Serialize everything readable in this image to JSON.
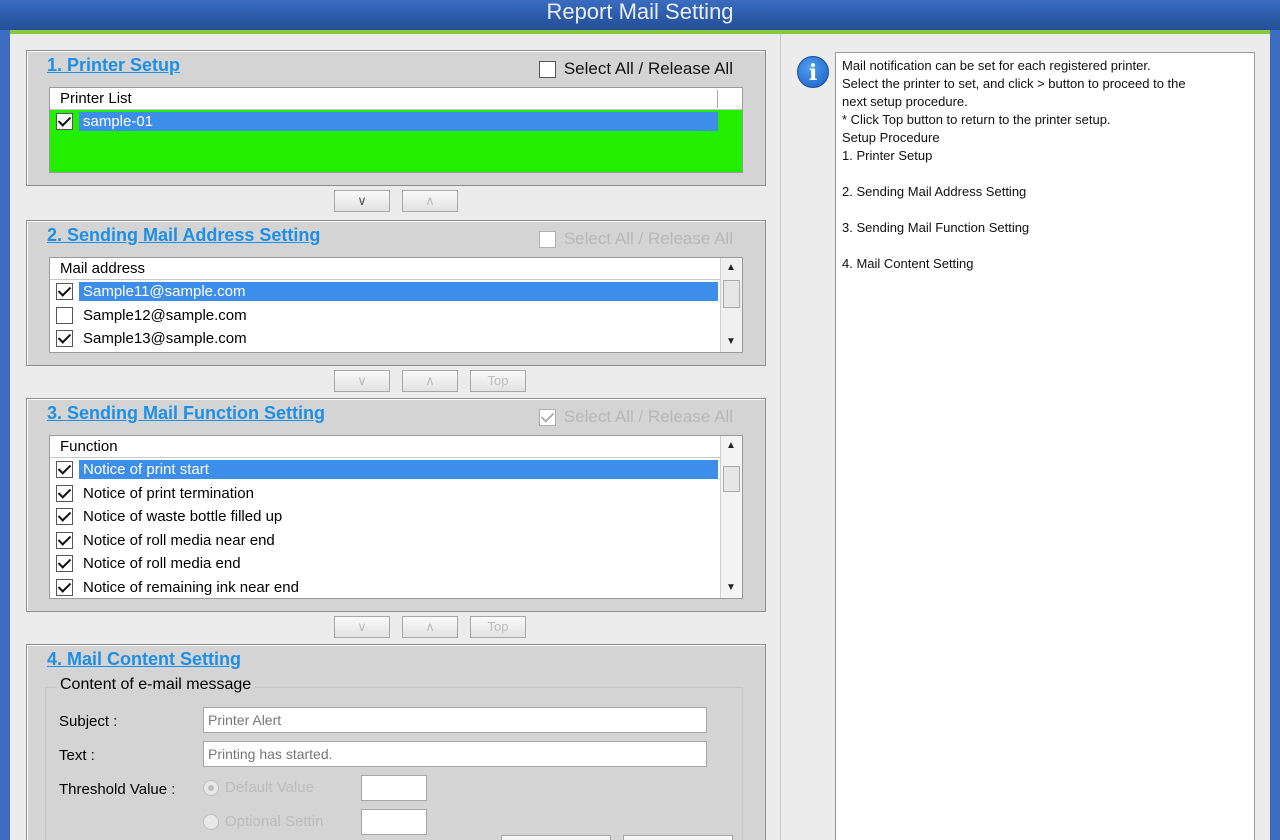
{
  "window": {
    "title": "Report Mail Setting"
  },
  "section1": {
    "title": "1. Printer Setup",
    "select_all_label": "Select All / Release All",
    "list_header": "Printer List",
    "items": [
      {
        "label": "sample-01",
        "checked": true,
        "selected": true
      }
    ]
  },
  "nav1": {
    "down": "∨",
    "up": "∧"
  },
  "section2": {
    "title": "2. Sending Mail Address Setting",
    "select_all_label": "Select All / Release All",
    "list_header": "Mail address",
    "items": [
      {
        "label": "Sample11@sample.com",
        "checked": true,
        "selected": true
      },
      {
        "label": "Sample12@sample.com",
        "checked": false,
        "selected": false
      },
      {
        "label": "Sample13@sample.com",
        "checked": true,
        "selected": false
      }
    ]
  },
  "nav2": {
    "down": "∨",
    "up": "∧",
    "top": "Top"
  },
  "section3": {
    "title": "3. Sending Mail Function Setting",
    "select_all_label": "Select All / Release All",
    "list_header": "Function",
    "items": [
      {
        "label": "Notice of print start",
        "checked": true,
        "selected": true
      },
      {
        "label": "Notice of print termination",
        "checked": true,
        "selected": false
      },
      {
        "label": "Notice of waste bottle filled up",
        "checked": true,
        "selected": false
      },
      {
        "label": "Notice of roll media near end",
        "checked": true,
        "selected": false
      },
      {
        "label": "Notice of roll media end",
        "checked": true,
        "selected": false
      },
      {
        "label": "Notice of remaining ink near end",
        "checked": true,
        "selected": false
      }
    ]
  },
  "nav3": {
    "down": "∨",
    "up": "∧",
    "top": "Top"
  },
  "section4": {
    "title": "4. Mail Content Setting",
    "group_label": "Content of e-mail message",
    "subject_label": "Subject :",
    "subject_value": "Printer Alert",
    "text_label": "Text :",
    "text_value": "Printing has started.",
    "threshold_label": "Threshold Value :",
    "default_value_label": "Default Value",
    "optional_setting_label": "Optional Settin"
  },
  "help": {
    "intro": "Mail notification can be set for each registered printer.\nSelect the printer to set, and click > button to proceed to the\nnext setup procedure.\n * Click Top button to return to the printer setup.",
    "procedure_title": "Setup Procedure",
    "steps": [
      "1. Printer Setup",
      "2. Sending Mail Address Setting",
      "3. Sending Mail Function Setting",
      "4. Mail Content Setting"
    ]
  },
  "colors": {
    "link_title": "#1e8fe6",
    "selection": "#3d8ee8",
    "printer_list_bg": "#22ee00",
    "title_bar": "#2b59a6",
    "accent_strip": "#86c940"
  }
}
